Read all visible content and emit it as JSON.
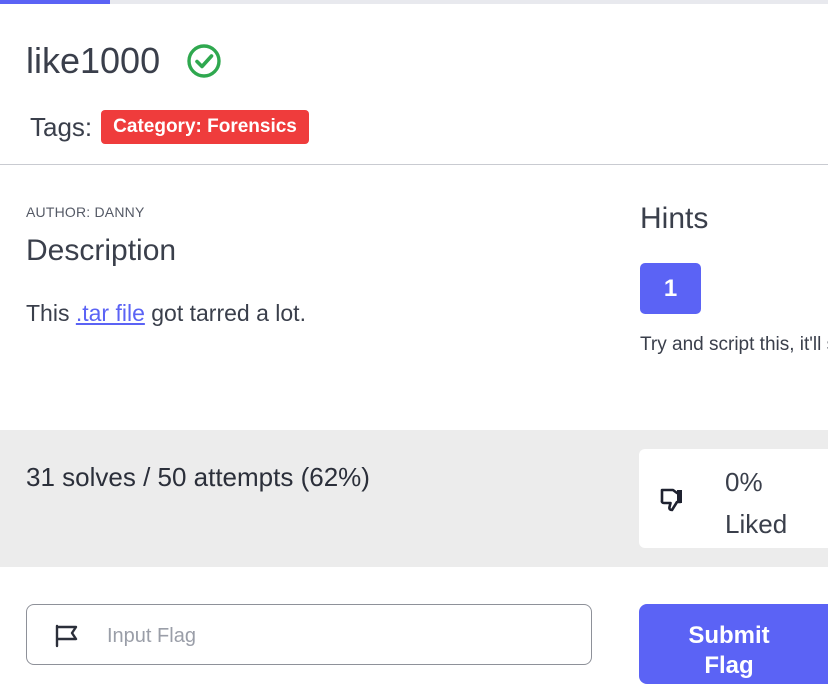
{
  "challenge": {
    "title": "like1000",
    "solved_icon": "check-circle-icon",
    "tags_label": "Tags:",
    "tag": "Category: Forensics",
    "tag_color": "#ef3c3c"
  },
  "description": {
    "author": "AUTHOR: DANNY",
    "heading": "Description",
    "text_before": "This ",
    "link_text": ".tar file",
    "text_after": " got tarred a lot."
  },
  "hints": {
    "heading": "Hints",
    "button_label": "1",
    "text": "Try and script this, it'll save you a lot of time"
  },
  "stats": {
    "text": "31 solves / 50 attempts (62%)",
    "like_icon": "thumbs-down-icon",
    "like_percent": "0%",
    "like_label": "Liked"
  },
  "flag_form": {
    "placeholder": "Input Flag",
    "flag_icon": "flag-icon",
    "submit_label": "Submit Flag"
  },
  "colors": {
    "accent": "#5b63f5",
    "success": "#2fa84f"
  }
}
